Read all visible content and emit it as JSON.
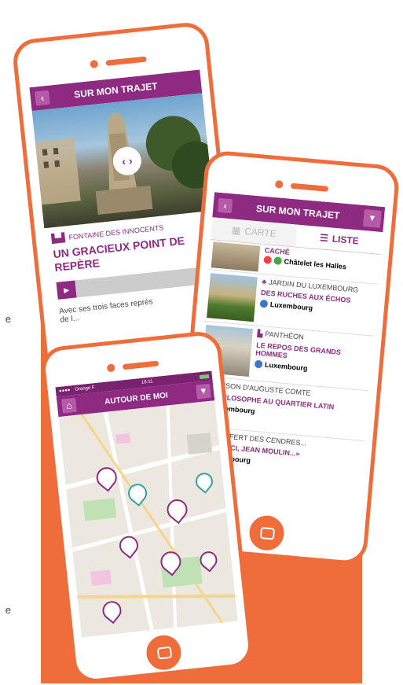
{
  "side_texts": [
    "e",
    "e"
  ],
  "phone1": {
    "header_title": "SUR MON TRAJET",
    "place_name": "FONTAINE DES INNOCENTS",
    "headline": "UN GRACIEUX POINT DE REPÈRE",
    "description": "Avec ses trois faces représ",
    "description2": "de l..."
  },
  "phone2": {
    "header_title": "SUR MON TRAJET",
    "tab_carte": "CARTE",
    "tab_liste": "LISTE",
    "items": [
      {
        "place": "",
        "headline": "CACHÉ",
        "station": "Châtelet les Halles"
      },
      {
        "place": "JARDIN DU LUXEMBOURG",
        "headline": "DES RUCHES AUX ÉCHOS",
        "station": "Luxembourg"
      },
      {
        "place": "PANTHÉON",
        "headline": "LE REPOS DES GRANDS HOMMES",
        "station": "Luxembourg"
      },
      {
        "place": "MAISON D'AUGUSTE COMTE",
        "headline": "UN PHILOSOPHE AU QUARTIER LATIN",
        "station": "Luxembourg"
      },
      {
        "place": "TRANSFERT DES CENDRES...",
        "headline": "«ENTRE ICI, JEAN MOULIN...»",
        "station": "Luxembourg"
      }
    ]
  },
  "phone3": {
    "status_carrier": "Orange F",
    "status_time": "18:11",
    "header_title": "AUTOUR DE MOI",
    "accent": "#8e2a82",
    "map_bg": "#ece8e0"
  }
}
